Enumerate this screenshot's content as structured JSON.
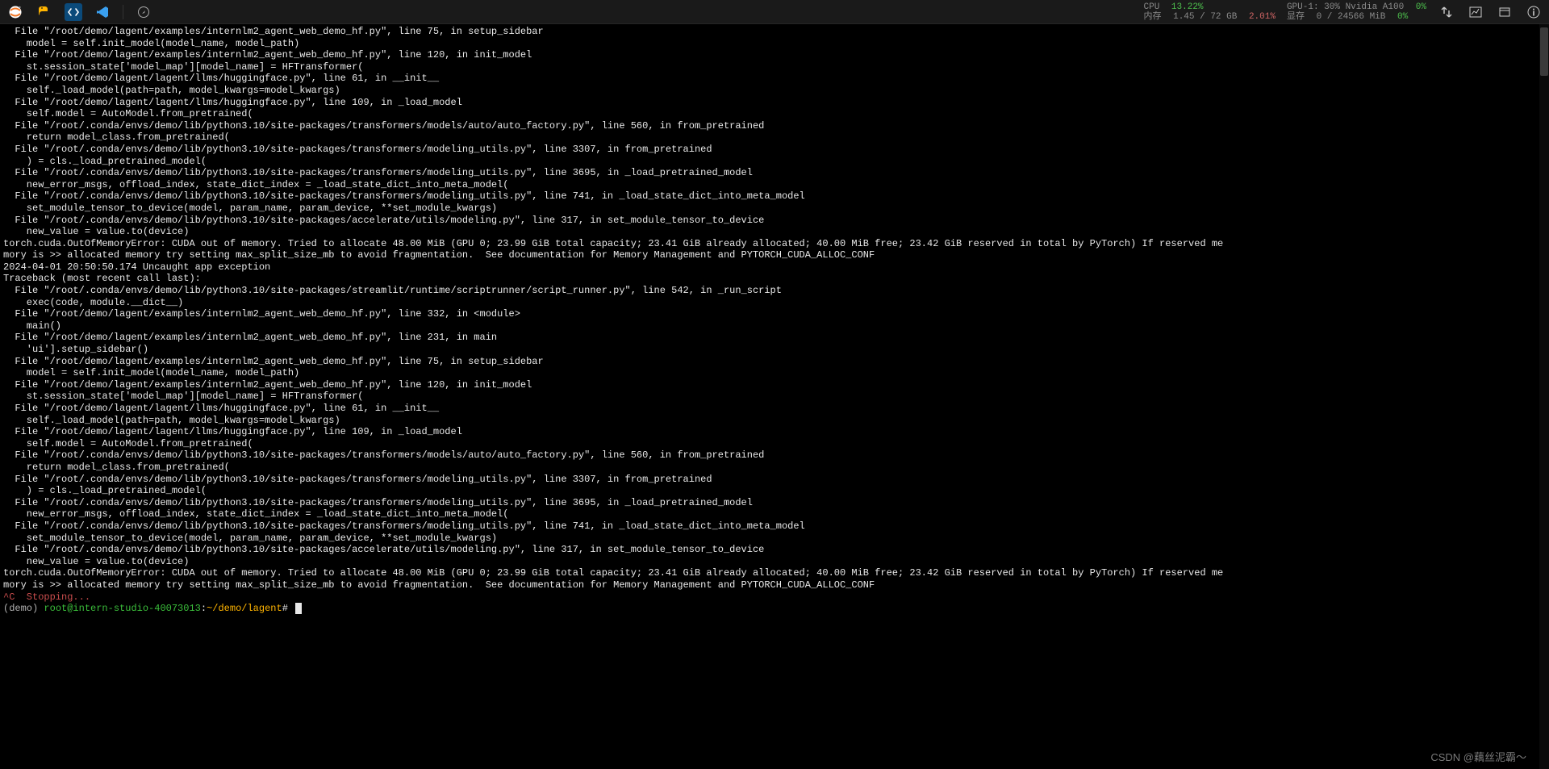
{
  "toolbar": {
    "icons": {
      "jupyter": "jupyter",
      "python": "python",
      "code": "code",
      "vscode": "vscode",
      "compass": "compass",
      "arrows": "arrows",
      "box": "box",
      "graph": "graph",
      "info": "info"
    }
  },
  "stats": {
    "cpu_label": "CPU",
    "cpu_pct": "13.22%",
    "mem_label": "内存",
    "mem_val": "1.45 / 72 GB",
    "mem_pct": "2.01%",
    "gpu_label": "GPU-1: 30% Nvidia A100",
    "gpu_pct": "0%",
    "vram_label": "显存",
    "vram_val": "0 / 24566 MiB",
    "vram_pct": "0%"
  },
  "traceback": [
    "  File \"/root/demo/lagent/examples/internlm2_agent_web_demo_hf.py\", line 75, in setup_sidebar",
    "    model = self.init_model(model_name, model_path)",
    "  File \"/root/demo/lagent/examples/internlm2_agent_web_demo_hf.py\", line 120, in init_model",
    "    st.session_state['model_map'][model_name] = HFTransformer(",
    "  File \"/root/demo/lagent/lagent/llms/huggingface.py\", line 61, in __init__",
    "    self._load_model(path=path, model_kwargs=model_kwargs)",
    "  File \"/root/demo/lagent/lagent/llms/huggingface.py\", line 109, in _load_model",
    "    self.model = AutoModel.from_pretrained(",
    "  File \"/root/.conda/envs/demo/lib/python3.10/site-packages/transformers/models/auto/auto_factory.py\", line 560, in from_pretrained",
    "    return model_class.from_pretrained(",
    "  File \"/root/.conda/envs/demo/lib/python3.10/site-packages/transformers/modeling_utils.py\", line 3307, in from_pretrained",
    "    ) = cls._load_pretrained_model(",
    "  File \"/root/.conda/envs/demo/lib/python3.10/site-packages/transformers/modeling_utils.py\", line 3695, in _load_pretrained_model",
    "    new_error_msgs, offload_index, state_dict_index = _load_state_dict_into_meta_model(",
    "  File \"/root/.conda/envs/demo/lib/python3.10/site-packages/transformers/modeling_utils.py\", line 741, in _load_state_dict_into_meta_model",
    "    set_module_tensor_to_device(model, param_name, param_device, **set_module_kwargs)",
    "  File \"/root/.conda/envs/demo/lib/python3.10/site-packages/accelerate/utils/modeling.py\", line 317, in set_module_tensor_to_device",
    "    new_value = value.to(device)",
    "torch.cuda.OutOfMemoryError: CUDA out of memory. Tried to allocate 48.00 MiB (GPU 0; 23.99 GiB total capacity; 23.41 GiB already allocated; 40.00 MiB free; 23.42 GiB reserved in total by PyTorch) If reserved memory is >> allocated memory try setting max_split_size_mb to avoid fragmentation.  See documentation for Memory Management and PYTORCH_CUDA_ALLOC_CONF",
    "2024-04-01 20:50:50.174 Uncaught app exception",
    "Traceback (most recent call last):",
    "  File \"/root/.conda/envs/demo/lib/python3.10/site-packages/streamlit/runtime/scriptrunner/script_runner.py\", line 542, in _run_script",
    "    exec(code, module.__dict__)",
    "  File \"/root/demo/lagent/examples/internlm2_agent_web_demo_hf.py\", line 332, in <module>",
    "    main()",
    "  File \"/root/demo/lagent/examples/internlm2_agent_web_demo_hf.py\", line 231, in main",
    "    'ui'].setup_sidebar()",
    "  File \"/root/demo/lagent/examples/internlm2_agent_web_demo_hf.py\", line 75, in setup_sidebar",
    "    model = self.init_model(model_name, model_path)",
    "  File \"/root/demo/lagent/examples/internlm2_agent_web_demo_hf.py\", line 120, in init_model",
    "    st.session_state['model_map'][model_name] = HFTransformer(",
    "  File \"/root/demo/lagent/lagent/llms/huggingface.py\", line 61, in __init__",
    "    self._load_model(path=path, model_kwargs=model_kwargs)",
    "  File \"/root/demo/lagent/lagent/llms/huggingface.py\", line 109, in _load_model",
    "    self.model = AutoModel.from_pretrained(",
    "  File \"/root/.conda/envs/demo/lib/python3.10/site-packages/transformers/models/auto/auto_factory.py\", line 560, in from_pretrained",
    "    return model_class.from_pretrained(",
    "  File \"/root/.conda/envs/demo/lib/python3.10/site-packages/transformers/modeling_utils.py\", line 3307, in from_pretrained",
    "    ) = cls._load_pretrained_model(",
    "  File \"/root/.conda/envs/demo/lib/python3.10/site-packages/transformers/modeling_utils.py\", line 3695, in _load_pretrained_model",
    "    new_error_msgs, offload_index, state_dict_index = _load_state_dict_into_meta_model(",
    "  File \"/root/.conda/envs/demo/lib/python3.10/site-packages/transformers/modeling_utils.py\", line 741, in _load_state_dict_into_meta_model",
    "    set_module_tensor_to_device(model, param_name, param_device, **set_module_kwargs)",
    "  File \"/root/.conda/envs/demo/lib/python3.10/site-packages/accelerate/utils/modeling.py\", line 317, in set_module_tensor_to_device",
    "    new_value = value.to(device)",
    "torch.cuda.OutOfMemoryError: CUDA out of memory. Tried to allocate 48.00 MiB (GPU 0; 23.99 GiB total capacity; 23.41 GiB already allocated; 40.00 MiB free; 23.42 GiB reserved in total by PyTorch) If reserved memory is >> allocated memory try setting max_split_size_mb to avoid fragmentation.  See documentation for Memory Management and PYTORCH_CUDA_ALLOC_CONF"
  ],
  "stopping_line": "^C  Stopping...",
  "prompt": {
    "env": "(demo) ",
    "user": "root@intern-studio-40073013",
    "colon": ":",
    "path": "~/demo/lagent",
    "hash": "# "
  },
  "watermark": "CSDN @藕丝泥霸～"
}
